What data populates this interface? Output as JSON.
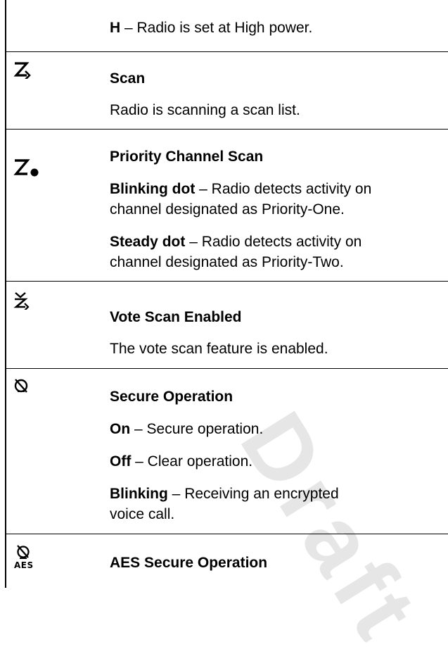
{
  "rows": [
    {
      "continuation": {
        "bold": "H",
        "text": " – Radio is set at High power."
      }
    },
    {
      "icon": "scan-icon",
      "title": "Scan",
      "lines": [
        "Radio is scanning a scan list."
      ]
    },
    {
      "icon": "priority-scan-icon",
      "title": "Priority Channel Scan",
      "items": [
        {
          "bold": "Blinking dot",
          "text": " – Radio detects activity on",
          "text2": "channel designated as Priority-One."
        },
        {
          "bold": "Steady dot",
          "text": " – Radio detects activity on",
          "text2": "channel designated as Priority-Two."
        }
      ]
    },
    {
      "icon": "vote-scan-icon",
      "title": "Vote Scan Enabled",
      "lines": [
        "The vote scan feature is enabled."
      ]
    },
    {
      "icon": "secure-icon",
      "title": "Secure Operation",
      "items": [
        {
          "bold": "On",
          "text": " – Secure operation."
        },
        {
          "bold": "Off",
          "text": " – Clear operation."
        },
        {
          "bold": "Blinking",
          "text": " – Receiving an encrypted",
          "text2": "voice call."
        }
      ]
    },
    {
      "icon": "aes-secure-icon",
      "icon_label": "AES",
      "title": "AES Secure Operation"
    }
  ]
}
